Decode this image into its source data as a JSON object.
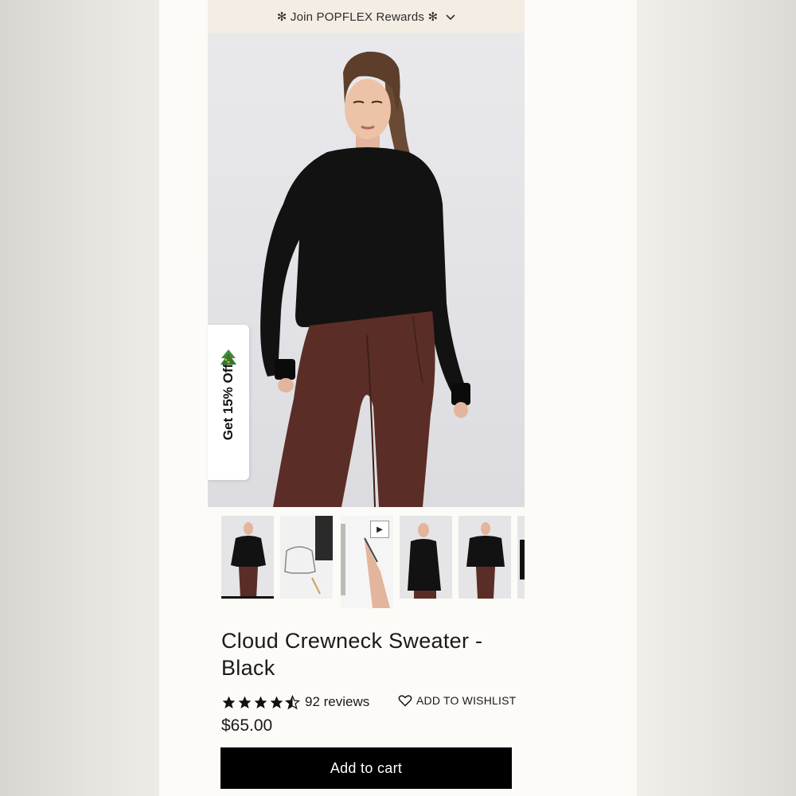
{
  "banner": {
    "text": "✻ Join POPFLEX Rewards ✻",
    "chevron": "chevron-down-icon"
  },
  "promo": {
    "label": "Get 15% Off",
    "icon": "christmas-tree-icon"
  },
  "product": {
    "title": "Cloud Crewneck Sweater - Black",
    "rating": 4.5,
    "reviews_label": "92 reviews",
    "wishlist_label": "ADD TO WISHLIST",
    "price": "$65.00",
    "add_to_cart_label": "Add to cart"
  },
  "gallery": {
    "active_index": 0,
    "thumbnails": [
      "model-front",
      "sketch-drawing",
      "video-sketch",
      "model-side",
      "model-front-2",
      "model-partial"
    ]
  },
  "colors": {
    "banner_bg": "#f3ede4",
    "page_bg": "#fdfbf7",
    "button_bg": "#000000",
    "sweater": "#111111",
    "leggings": "#5a2e26"
  }
}
